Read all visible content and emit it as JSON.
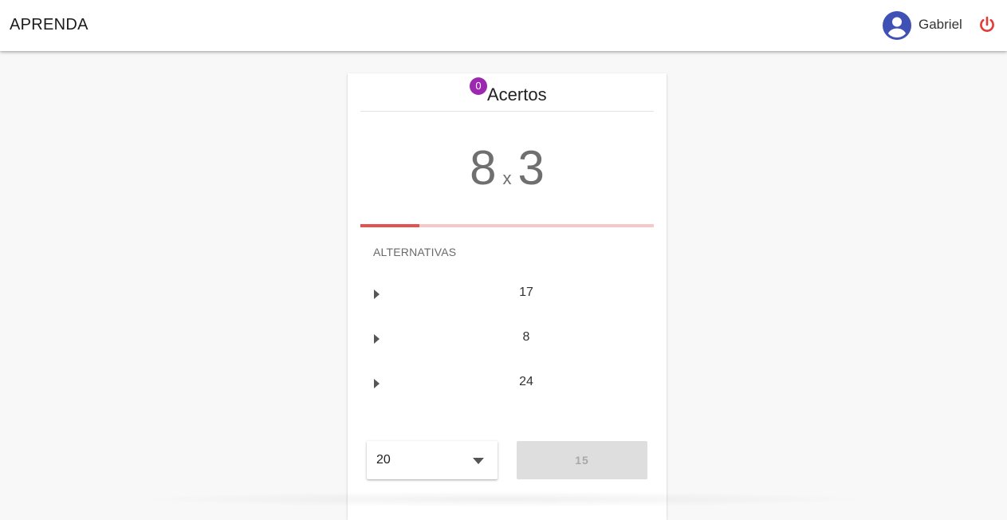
{
  "app": {
    "brand": "APRENDA",
    "user_name": "Gabriel"
  },
  "icons": {
    "avatar": "account-circle-icon",
    "power": "power-icon",
    "option_arrow": "arrow-right-icon",
    "select_caret": "chevron-down-icon"
  },
  "colors": {
    "avatar": "#3f51b5",
    "power": "#e53935",
    "badge": "#9c27b0",
    "progress_fill": "#e55050",
    "progress_track": "#f6c9c9"
  },
  "card": {
    "score_count": "0",
    "title": "Acertos",
    "question": {
      "left": "8",
      "operator": "x",
      "right": "3"
    },
    "progress_fraction": 0.2,
    "alternatives_label": "ALTERNATIVAS",
    "alternatives": [
      "17",
      "8",
      "24"
    ],
    "select_value": "20",
    "submit_label": "15"
  }
}
